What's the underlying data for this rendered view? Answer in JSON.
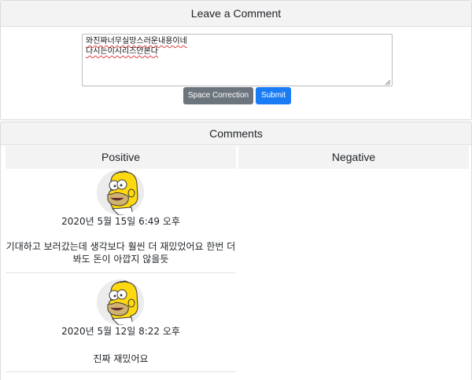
{
  "comment_form": {
    "header": "Leave a Comment",
    "textarea_lines": [
      "와진짜너무실망스러운내용이네",
      "다시는이시리즈안본다"
    ],
    "space_correction_label": "Space Correction",
    "submit_label": "Submit"
  },
  "comments": {
    "header": "Comments",
    "positive_label": "Positive",
    "negative_label": "Negative",
    "positive_items": [
      {
        "date": "2020년 5월 15일 6:49 오후",
        "text": "기대하고 보러갔는데 생각보다 훨씬 더 재밌었어요 한번 더 봐도 돈이 아깝지 않을듯"
      },
      {
        "date": "2020년 5월 12일 8:22 오후",
        "text": "진짜 재밌어요"
      }
    ],
    "negative_items": []
  },
  "colors": {
    "secondary_button": "#6c757d",
    "primary_button": "#1a7cf5",
    "header_bg": "#f3f3f3",
    "spellcheck_underline": "#e04040"
  },
  "icons": {
    "avatar": "homer-simpson-avatar-icon",
    "resize": "resize-handle-icon"
  }
}
